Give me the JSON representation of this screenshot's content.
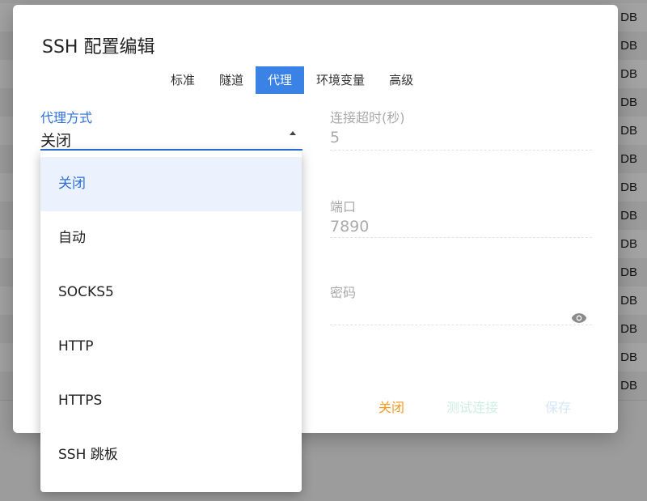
{
  "background": {
    "row_label": "DB",
    "row_count": 14
  },
  "dialog": {
    "title": "SSH 配置编辑",
    "tabs": [
      {
        "label": "标准",
        "active": false
      },
      {
        "label": "隧道",
        "active": false
      },
      {
        "label": "代理",
        "active": true
      },
      {
        "label": "环境变量",
        "active": false
      },
      {
        "label": "高级",
        "active": false
      }
    ],
    "proxy_mode": {
      "label": "代理方式",
      "value": "关闭"
    },
    "timeout": {
      "label": "连接超时(秒)",
      "value": "5"
    },
    "port": {
      "label": "端口",
      "value": "7890"
    },
    "password": {
      "label": "密码",
      "value": ""
    },
    "actions": {
      "close": "关闭",
      "test": "测试连接",
      "save": "保存"
    }
  },
  "dropdown": {
    "options": [
      "关闭",
      "自动",
      "SOCKS5",
      "HTTP",
      "HTTPS",
      "SSH 跳板"
    ],
    "selected": "关闭"
  },
  "colors": {
    "accent": "#2f6fd6",
    "tab_active": "#3b82e6",
    "close_btn": "#f59a23"
  }
}
